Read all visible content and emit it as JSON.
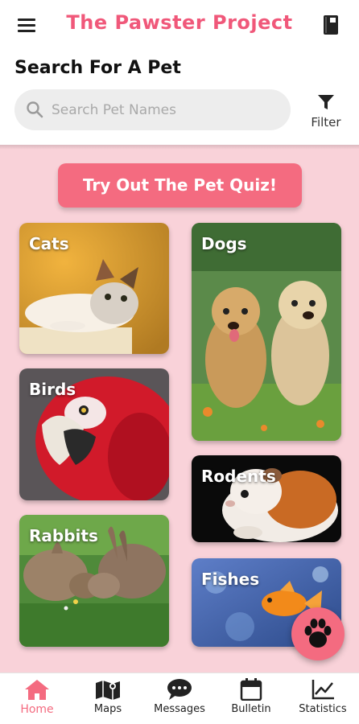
{
  "header": {
    "app_title": "The Pawster Project",
    "search_heading": "Search For A Pet",
    "search_placeholder": "Search Pet Names",
    "filter_label": "Filter"
  },
  "quiz": {
    "label": "Try Out The Pet Quiz!"
  },
  "categories": [
    {
      "label": "Cats"
    },
    {
      "label": "Dogs"
    },
    {
      "label": "Birds"
    },
    {
      "label": "Rodents"
    },
    {
      "label": "Rabbits"
    },
    {
      "label": "Fishes"
    }
  ],
  "nav": {
    "items": [
      {
        "label": "Home",
        "icon": "home-icon",
        "active": true
      },
      {
        "label": "Maps",
        "icon": "map-icon",
        "active": false
      },
      {
        "label": "Messages",
        "icon": "chat-icon",
        "active": false
      },
      {
        "label": "Bulletin",
        "icon": "calendar-icon",
        "active": false
      },
      {
        "label": "Statistics",
        "icon": "chart-icon",
        "active": false
      }
    ]
  },
  "colors": {
    "accent": "#f46b80",
    "title": "#f0587a",
    "background": "#f9d2d9"
  }
}
